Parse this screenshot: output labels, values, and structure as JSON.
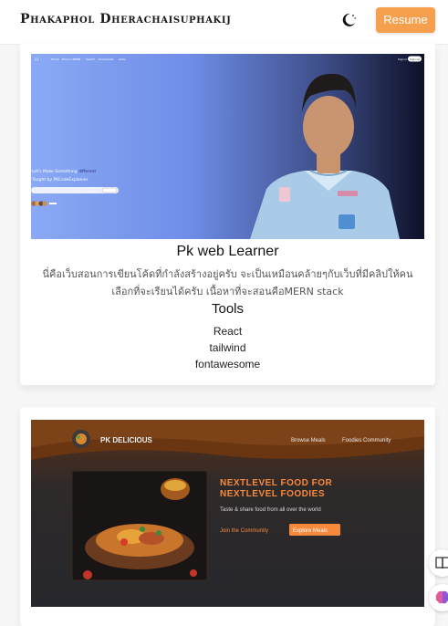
{
  "header": {
    "name": "Phakaphol Dherachaisuphakij",
    "resume_label": "Resume"
  },
  "projects": [
    {
      "title": "Pk web Learner",
      "description": "นี่คือเว็บสอนการเขียนโค้ดที่กำลังสร้างอยู่ครับ จะเป็นเหมือนคล้ายๆกับเว็บที่มีคลิปให้คนเลือกที่จะเรียนได้ครับ เนื้อหาที่จะสอนคือMERN stack",
      "tools_heading": "Tools",
      "tools": [
        "React",
        "tailwind",
        "fontawesome"
      ],
      "preview": {
        "nav_links": [
          "Home",
          "How to MERN",
          "Search",
          "Downloads",
          "Links"
        ],
        "signin_label": "Sign in",
        "signup_label": "Sign up",
        "hero_line_1": "Let's Make Something",
        "hero_line_1_highlight": "different",
        "hero_line_2": "Taught by PKCodeExplainer"
      }
    },
    {
      "preview": {
        "brand": "PK DELICIOUS",
        "nav_links": [
          "Browse Meals",
          "Foodies Community"
        ],
        "headline_1": "NEXTLEVEL FOOD FOR",
        "headline_2": "NEXTLEVEL FOODIES",
        "subtitle": "Taste & share food from all over the world",
        "join_label": "Join the Community",
        "explore_label": "Explore Meals"
      }
    }
  ],
  "icons": {
    "theme": "moon-icon",
    "side_1": "book-icon",
    "side_2": "brain-icon"
  },
  "colors": {
    "accent": "#f6a04d",
    "food_accent": "#f7893b"
  }
}
